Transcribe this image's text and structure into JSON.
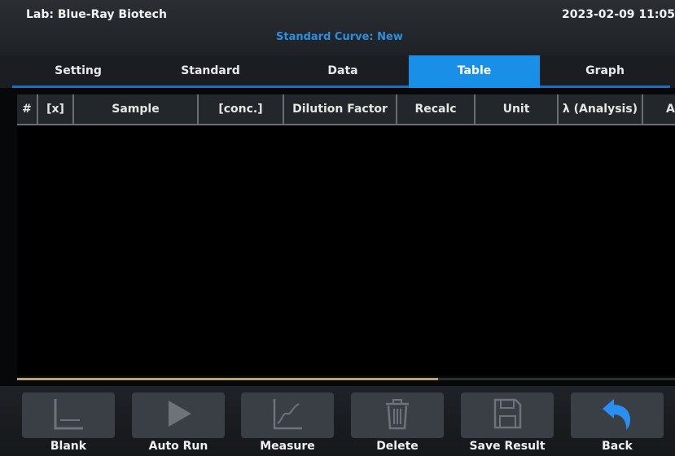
{
  "header": {
    "lab": "Lab: Blue-Ray Biotech",
    "datetime": "2023-02-09 11:05",
    "subtitle": "Standard Curve: New"
  },
  "tabs": [
    {
      "label": "Setting"
    },
    {
      "label": "Standard"
    },
    {
      "label": "Data"
    },
    {
      "label": "Table",
      "active": true
    },
    {
      "label": "Graph"
    }
  ],
  "table": {
    "columns": [
      "#",
      "[x]",
      "Sample",
      "[conc.]",
      "Dilution Factor",
      "Recalc",
      "Unit",
      "λ (Analysis)",
      "A"
    ],
    "rows": []
  },
  "scroll_progress": 0.64,
  "toolbar": {
    "blank": "Blank",
    "auto_run": "Auto Run",
    "measure": "Measure",
    "delete": "Delete",
    "save_result": "Save Result",
    "back": "Back"
  },
  "colors": {
    "accent": "#1a8fe8",
    "subtitle": "#2a8fe0",
    "back_icon": "#2a8ff0",
    "progress": "#b7a27a"
  }
}
